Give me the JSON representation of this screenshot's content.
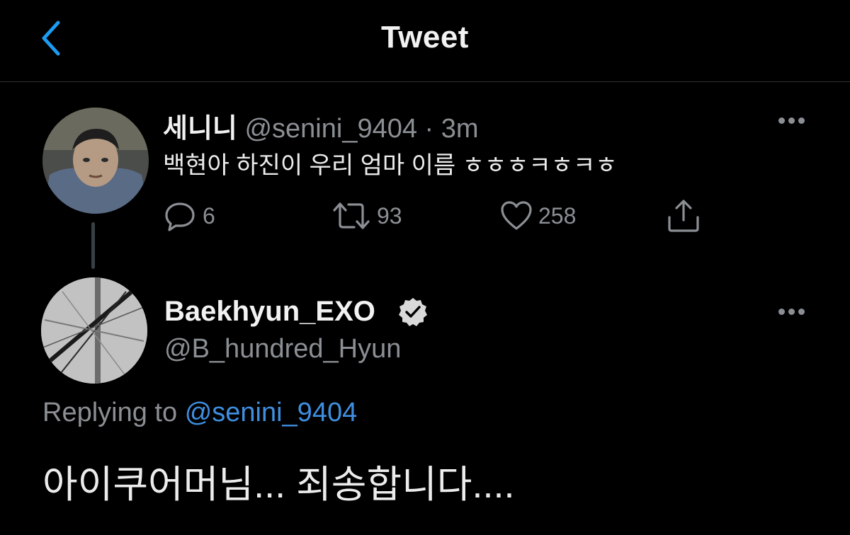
{
  "header": {
    "title": "Tweet",
    "back_icon": "chevron-left-icon"
  },
  "colors": {
    "background": "#000000",
    "accent": "#1d9bf0",
    "muted": "#8b8f94",
    "divider": "#2f3336"
  },
  "parent_tweet": {
    "display_name": "세니니",
    "handle": "@senini_9404",
    "separator": "·",
    "time": "3m",
    "text": "백현아 하진이 우리 엄마 이름 ㅎㅎㅎㅋㅎㅋㅎ",
    "replies": "6",
    "retweets": "93",
    "likes": "258"
  },
  "reply_tweet": {
    "display_name": "Baekhyun_EXO",
    "verified": true,
    "handle": "@B_hundred_Hyun",
    "replying_to_label": "Replying to",
    "replying_to_handle": "@senini_9404",
    "text": "아이쿠어머님... 죄송합니다...."
  }
}
